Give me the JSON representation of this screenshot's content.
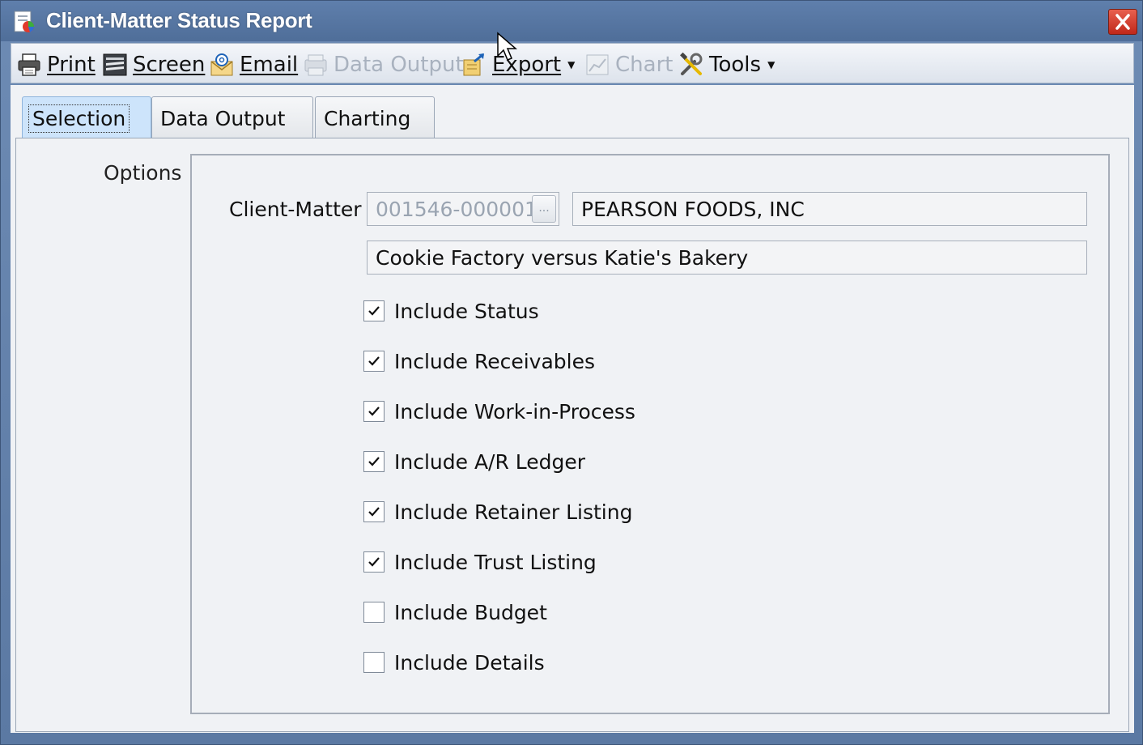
{
  "window": {
    "title": "Client-Matter Status Report"
  },
  "toolbar": {
    "print": {
      "label": "Print",
      "icon": "printer-icon",
      "enabled": true
    },
    "screen": {
      "label": "Screen",
      "icon": "screen-icon",
      "enabled": true
    },
    "email": {
      "label": "Email",
      "icon": "email-icon",
      "enabled": true
    },
    "data_output": {
      "label": "Data Output",
      "icon": "data-output-icon",
      "enabled": false
    },
    "export": {
      "label": "Export",
      "icon": "export-icon",
      "enabled": true,
      "has_dropdown": true
    },
    "chart": {
      "label": "Chart",
      "icon": "chart-icon",
      "enabled": false
    },
    "tools": {
      "label": "Tools",
      "icon": "tools-icon",
      "enabled": true,
      "has_dropdown": true
    }
  },
  "tabs": [
    {
      "label": "Selection",
      "active": true
    },
    {
      "label": "Data Output",
      "active": false
    },
    {
      "label": "Charting",
      "active": false
    }
  ],
  "options": {
    "group_label": "Options",
    "client_matter_label": "Client-Matter",
    "client_matter_value": "001546-000001",
    "client_name": "PEARSON FOODS, INC",
    "matter_description": "Cookie Factory versus Katie's Bakery",
    "lookup_button_label": "...",
    "checkboxes": [
      {
        "label": "Include Status",
        "checked": true
      },
      {
        "label": "Include Receivables",
        "checked": true
      },
      {
        "label": "Include Work-in-Process",
        "checked": true
      },
      {
        "label": "Include A/R Ledger",
        "checked": true
      },
      {
        "label": "Include Retainer Listing",
        "checked": true
      },
      {
        "label": "Include Trust Listing",
        "checked": true
      },
      {
        "label": "Include Budget",
        "checked": false
      },
      {
        "label": "Include Details",
        "checked": false
      }
    ]
  },
  "colors": {
    "titlebar": "#5274a3",
    "active_tab": "#cde4fb",
    "close_button": "#d33a2a"
  }
}
